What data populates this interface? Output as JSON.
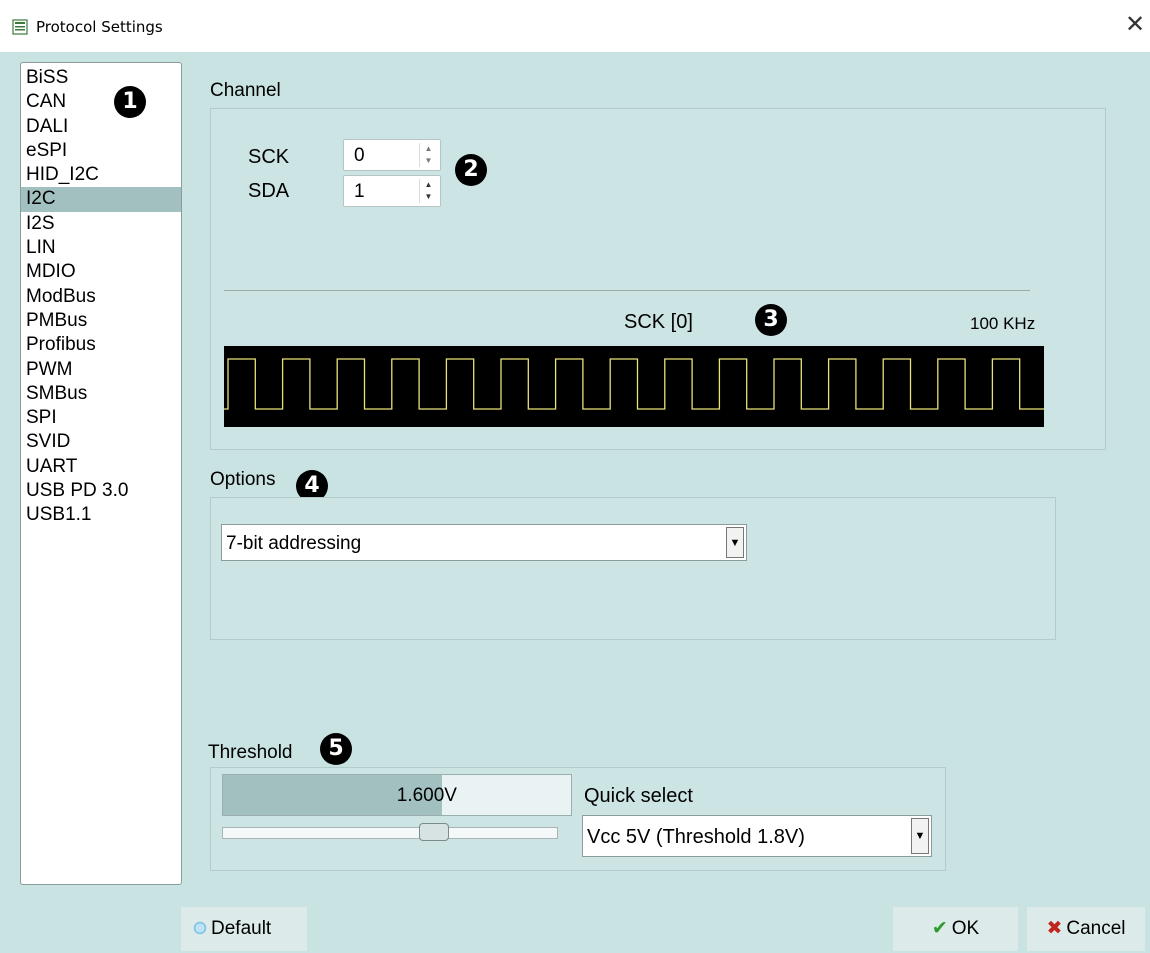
{
  "window": {
    "title": "Protocol Settings",
    "close_glyph": "✕"
  },
  "protocols": {
    "items": [
      "BiSS",
      "CAN",
      "DALI",
      "eSPI",
      "HID_I2C",
      "I2C",
      "I2S",
      "LIN",
      "MDIO",
      "ModBus",
      "PMBus",
      "Profibus",
      "PWM",
      "SMBus",
      "SPI",
      "SVID",
      "UART",
      "USB PD 3.0",
      "USB1.1"
    ],
    "selected": "I2C"
  },
  "badges": [
    "1",
    "2",
    "3",
    "4",
    "5"
  ],
  "channel": {
    "label": "Channel",
    "sck_label": "SCK",
    "sck_value": "0",
    "sda_label": "SDA",
    "sda_value": "1",
    "signal_label": "SCK [0]",
    "frequency": "100 KHz",
    "waveform_color": "#e8e27a",
    "waveform_cycles": 16
  },
  "options": {
    "label": "Options",
    "addressing": "7-bit addressing"
  },
  "threshold": {
    "label": "Threshold",
    "value": "1.600V",
    "level_fraction": 0.63,
    "quick_select_label": "Quick select",
    "quick_select_value": "Vcc 5V (Threshold 1.8V)"
  },
  "buttons": {
    "default": "Default",
    "ok": "OK",
    "cancel": "Cancel"
  },
  "colors": {
    "background": "#c9e3e3",
    "selected": "#a3c0c0",
    "ok_check": "#2e9a2e",
    "cancel_x": "#c0261f"
  }
}
